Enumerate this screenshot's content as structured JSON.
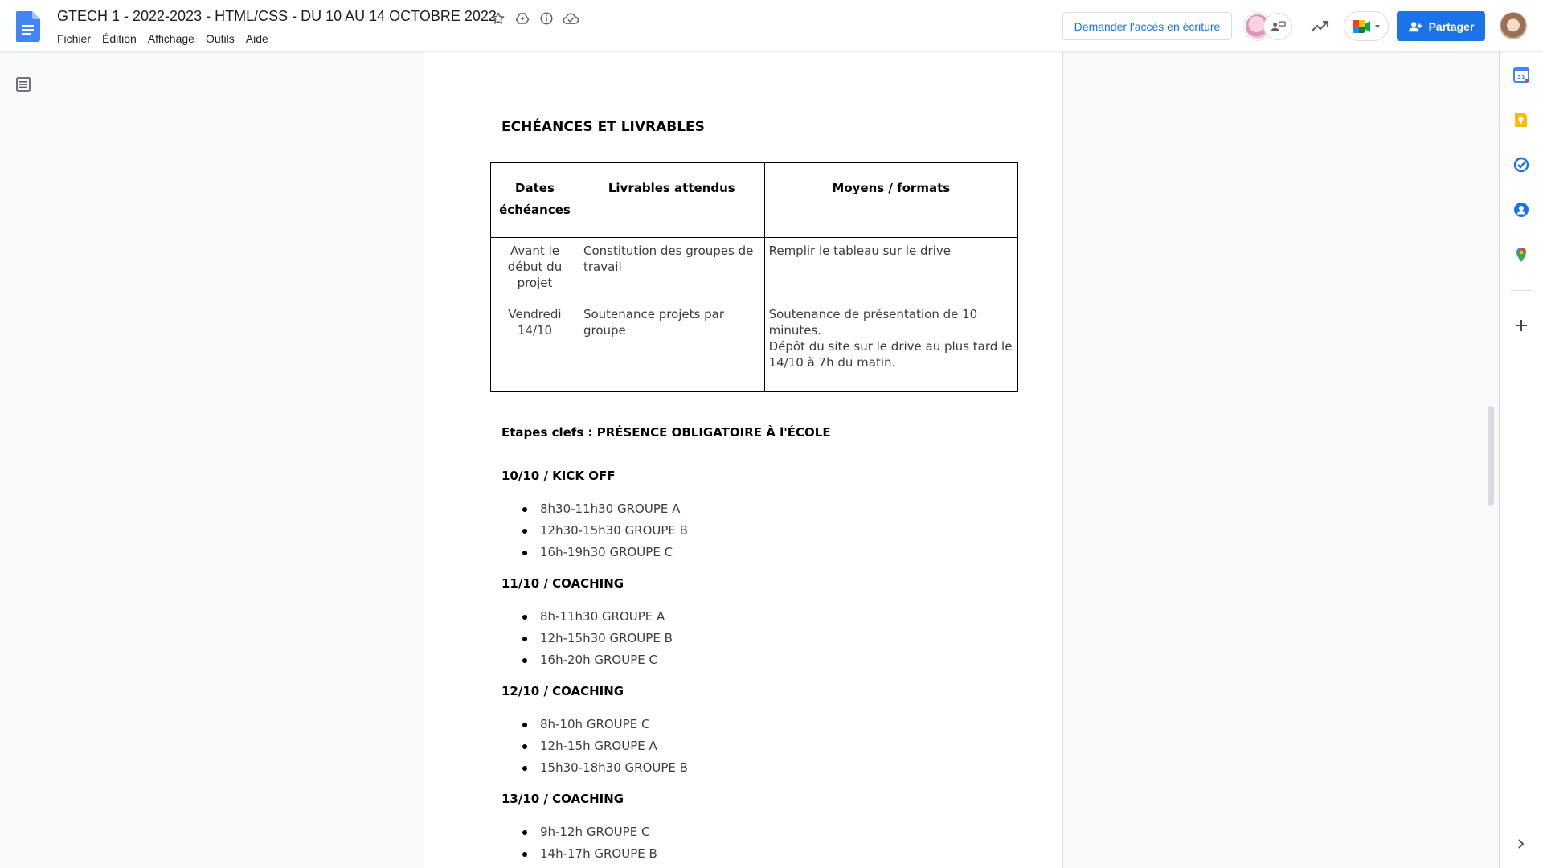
{
  "header": {
    "title": "GTECH 1 - 2022-2023 - HTML/CSS - DU 10 AU 14 OCTOBRE 2022",
    "menu": [
      "Fichier",
      "Édition",
      "Affichage",
      "Outils",
      "Aide"
    ],
    "request_access": "Demander l'accès en écriture",
    "share_label": "Partager",
    "title_icons": [
      "star-icon",
      "move-to-drive-icon",
      "info-icon",
      "cloud-saved-icon"
    ],
    "accent": "#1a73e8"
  },
  "document": {
    "section_title": "ECHÉANCES ET LIVRABLES",
    "table": {
      "headers": [
        "Dates échéances",
        "Livrables attendus",
        "Moyens / formats"
      ],
      "rows": [
        [
          "Avant le début du projet",
          "Constitution des groupes de travail",
          "Remplir le tableau sur le drive"
        ],
        [
          "Vendredi 14/10",
          "Soutenance projets par groupe",
          "Soutenance de présentation de 10 minutes.",
          "Dépôt du site sur le drive au plus tard le 14/10 à 7h du matin."
        ]
      ]
    },
    "milestones_title": "Etapes clefs : PRÉSENCE OBLIGATOIRE À l'ÉCOLE",
    "days": [
      {
        "heading": "10/10  / KICK OFF",
        "items": [
          "8h30-11h30 GROUPE A",
          "12h30-15h30 GROUPE B",
          "16h-19h30 GROUPE C"
        ]
      },
      {
        "heading": "11/10 / COACHING",
        "items": [
          "8h-11h30 GROUPE A",
          "12h-15h30 GROUPE B",
          "16h-20h GROUPE C"
        ]
      },
      {
        "heading": "12/10 / COACHING",
        "items": [
          "8h-10h GROUPE C",
          "12h-15h GROUPE A",
          "15h30-18h30 GROUPE B"
        ]
      },
      {
        "heading": "13/10 / COACHING",
        "items": [
          "9h-12h GROUPE C",
          "14h-17h GROUPE B"
        ]
      }
    ]
  },
  "side_panel": {
    "icons": [
      "calendar-icon",
      "keep-icon",
      "tasks-icon",
      "contacts-icon",
      "maps-icon",
      "add-icon",
      "expand-panel-icon"
    ],
    "calendar_day": "31"
  }
}
